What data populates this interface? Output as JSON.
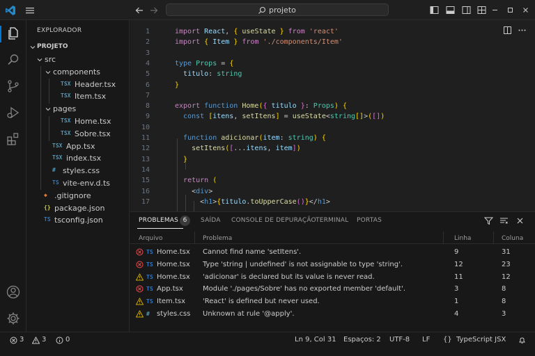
{
  "titlebar": {
    "search_text": "projeto",
    "icons": [
      "vscode-logo-icon",
      "menu-icon",
      "arrow-left-icon",
      "arrow-right-icon",
      "search-icon",
      "toggle-sidebar-icon",
      "toggle-panel-icon",
      "toggle-secondary-sidebar-icon",
      "customize-layout-icon",
      "minimize-icon",
      "maximize-icon",
      "close-icon"
    ]
  },
  "sidebar": {
    "title": "EXPLORADOR",
    "project": "PROJETO",
    "tree": [
      {
        "label": "src",
        "type": "folder",
        "depth": 1
      },
      {
        "label": "components",
        "type": "folder",
        "depth": 2
      },
      {
        "label": "Header.tsx",
        "type": "tsx",
        "depth": 3,
        "badge": "TSX"
      },
      {
        "label": "Item.tsx",
        "type": "tsx",
        "depth": 3,
        "badge": "TSX"
      },
      {
        "label": "pages",
        "type": "folder",
        "depth": 2
      },
      {
        "label": "Home.tsx",
        "type": "tsx",
        "depth": 3,
        "badge": "TSX"
      },
      {
        "label": "Sobre.tsx",
        "type": "tsx",
        "depth": 3,
        "badge": "TSX"
      },
      {
        "label": "App.tsx",
        "type": "tsx",
        "depth": 2,
        "badge": "TSX"
      },
      {
        "label": "index.tsx",
        "type": "tsx",
        "depth": 2,
        "badge": "TSX"
      },
      {
        "label": "styles.css",
        "type": "css",
        "depth": 2,
        "badge": "#"
      },
      {
        "label": "vite-env.d.ts",
        "type": "ts",
        "depth": 2,
        "badge": "TS"
      },
      {
        "label": ".gitignore",
        "type": "git",
        "depth": 1,
        "badge": "◆"
      },
      {
        "label": "package.json",
        "type": "json",
        "depth": 1,
        "badge": "{}"
      },
      {
        "label": "tsconfig.json",
        "type": "tsjson",
        "depth": 1,
        "badge": "TS"
      }
    ]
  },
  "editor": {
    "lines": [
      "import React, { useState } from 'react'",
      "import { Item } from './components/Item'",
      "",
      "type Props = {",
      "  titulo: string",
      "}",
      "",
      "export function Home({ titulo }: Props) {",
      "  const [itens, setItens] = useState<string[]>([])",
      "",
      "  function adicionar(item: string) {",
      "    setItens([...itens, item])",
      "  }",
      "",
      "  return (",
      "    <div>",
      "      <h1>{titulo.toUpperCase()}</h1>"
    ],
    "line_numbers": [
      "1",
      "2",
      "3",
      "4",
      "5",
      "6",
      "7",
      "8",
      "9",
      "10",
      "11",
      "12",
      "13",
      "14",
      "15",
      "16",
      "17"
    ]
  },
  "panel": {
    "tabs": [
      "PROBLEMAS",
      "SAÍDA",
      "CONSOLE DE DEPURAÇÃO",
      "TERMINAL",
      "PORTAS"
    ],
    "problem_count": "6",
    "columns": {
      "file": "Arquivo",
      "problem": "Problema",
      "line": "Linha",
      "column": "Coluna"
    },
    "problems": [
      {
        "severity": "error",
        "ftype": "TS",
        "file": "Home.tsx",
        "message": "Cannot find name 'setItens'.",
        "line": "9",
        "col": "31"
      },
      {
        "severity": "error",
        "ftype": "TS",
        "file": "Home.tsx",
        "message": "Type 'string | undefined' is not assignable to type 'string'.",
        "line": "12",
        "col": "23"
      },
      {
        "severity": "warning",
        "ftype": "TS",
        "file": "Home.tsx",
        "message": "'adicionar' is declared but its value is never read.",
        "line": "11",
        "col": "12"
      },
      {
        "severity": "error",
        "ftype": "TS",
        "file": "App.tsx",
        "message": "Module './pages/Sobre' has no exported member 'default'.",
        "line": "3",
        "col": "8"
      },
      {
        "severity": "warning",
        "ftype": "TS",
        "file": "Item.tsx",
        "message": "'React' is defined but never used.",
        "line": "1",
        "col": "8"
      },
      {
        "severity": "warning",
        "ftype": "#",
        "file": "styles.css",
        "message": "Unknown at rule '@apply'.",
        "line": "4",
        "col": "3"
      }
    ]
  },
  "statusbar": {
    "errors": "3",
    "warnings": "3",
    "infos": "0",
    "cursor": "Ln 9, Col 31",
    "spaces": "Espaços: 2",
    "encoding": "UTF-8",
    "eol": "LF",
    "braces": "{}",
    "language": "TypeScript JSX"
  },
  "colors": {
    "accent": "#0078d4",
    "error": "#f14c4c",
    "warning": "#cca700",
    "ts": "#3178c6",
    "tsx": "#519aba"
  }
}
